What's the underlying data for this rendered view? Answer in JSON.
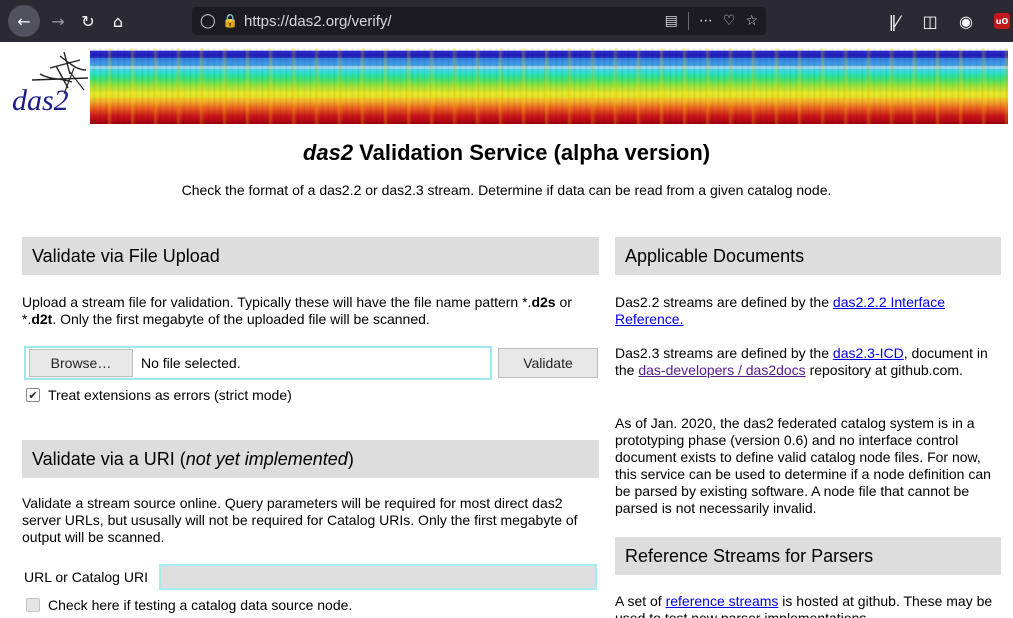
{
  "browser": {
    "url": "https://das2.org/verify/",
    "icons": {
      "back": "arrow-left-icon",
      "forward": "arrow-right-icon",
      "reload": "reload-icon",
      "home": "home-icon",
      "tracking": "shield-icon",
      "lock": "lock-icon",
      "reader": "reader-view-icon",
      "more": "more-icon",
      "pocket": "pocket-icon",
      "bookmark": "star-icon",
      "library": "library-icon",
      "sidebar": "sidebar-icon",
      "account": "account-icon",
      "ublock": "ublock-icon",
      "menu": "hamburger-icon"
    }
  },
  "header": {
    "logo_text": "das2",
    "title_em": "das2",
    "title_rest": " Validation Service (alpha version)",
    "subtitle": "Check the format of a das2.2 or das2.3 stream. Determine if data can be read from a given catalog node."
  },
  "upload": {
    "heading": "Validate via File Upload",
    "desc_1": "Upload a stream file for validation. Typically these will have the file name pattern *.",
    "ext_1": "d2s",
    "desc_2": " or *.",
    "ext_2": "d2t",
    "desc_3": ". Only the first megabyte of the uploaded file will be scanned.",
    "browse_label": "Browse…",
    "file_status": "No file selected.",
    "validate_label": "Validate",
    "strict_label": "Treat extensions as errors (strict mode)",
    "strict_checked": true
  },
  "uri": {
    "heading_1": "Validate via a URI (",
    "heading_em": "not yet implemented",
    "heading_2": ")",
    "desc": "Validate a stream source online. Query parameters will be required for most direct das2 server URLs, but ususally will not be required for Catalog URIs. Only the first megabyte of output will be scanned.",
    "label": "URL or Catalog URI",
    "value": "",
    "catalog_check_label": "Check here if testing a catalog data source node.",
    "catalog_checked": false
  },
  "docs": {
    "heading": "Applicable Documents",
    "p1_text": "Das2.2 streams are defined by the ",
    "p1_link": "das2.2.2 Interface Reference.",
    "p2_text_1": "Das2.3 streams are defined by the ",
    "p2_link_1": "das2.3-ICD",
    "p2_text_2": ", document in the ",
    "p2_link_2": "das-developers / das2docs",
    "p2_text_3": " repository at github.com.",
    "p3": "As of Jan. 2020, the das2 federated catalog system is in a prototyping phase (version 0.6) and no interface control document exists to define valid catalog node files. For now, this service can be used to determine if a node definition can be parsed by existing software. A node file that cannot be parsed is not necessarily invalid."
  },
  "refstreams": {
    "heading": "Reference Streams for Parsers",
    "p_text_1": "A set of ",
    "p_link": "reference streams",
    "p_text_2": " is hosted at github. These may be used to test new parser implementations."
  }
}
